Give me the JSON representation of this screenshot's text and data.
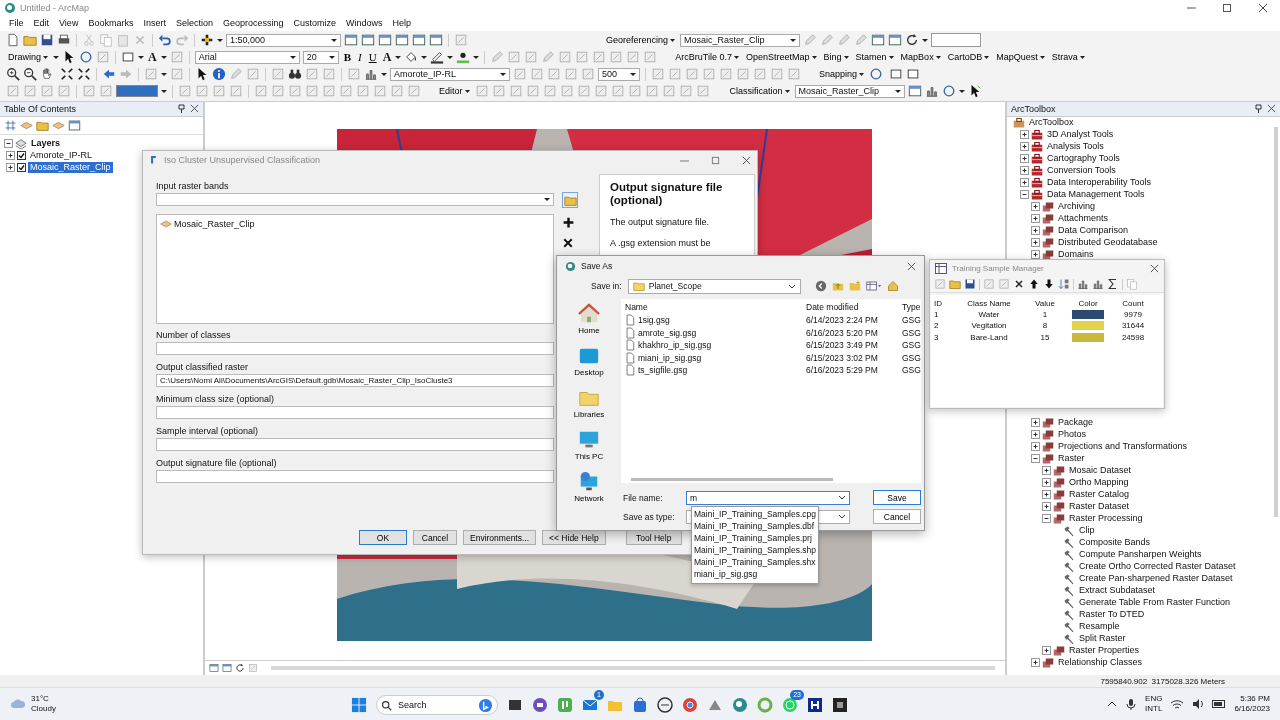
{
  "window": {
    "title": "Untitled - ArcMap"
  },
  "menu": [
    "File",
    "Edit",
    "View",
    "Bookmarks",
    "Insert",
    "Selection",
    "Geoprocessing",
    "Customize",
    "Windows",
    "Help"
  ],
  "toolbars": [
    [
      {
        "kind": "combo",
        "value": "1:50,000"
      },
      {
        "kind": "menu",
        "label": "Georeferencing"
      },
      {
        "kind": "combo",
        "value": "Mosaic_Raster_Clip"
      }
    ],
    [
      {
        "kind": "menu",
        "label": "Drawing"
      },
      {
        "kind": "glyph",
        "label": "A"
      },
      {
        "kind": "combo",
        "value": "Arial"
      },
      {
        "kind": "combo",
        "value": "20"
      },
      {
        "kind": "bold",
        "label": "B"
      },
      {
        "kind": "italic",
        "label": "I"
      },
      {
        "kind": "underline",
        "label": "U"
      },
      {
        "kind": "glyph",
        "label": "A"
      },
      {
        "kind": "menu",
        "label": "ArcBruTile 0.7"
      },
      {
        "kind": "menu",
        "label": "OpenStreetMap"
      },
      {
        "kind": "menu",
        "label": "Bing"
      },
      {
        "kind": "menu",
        "label": "Stamen"
      },
      {
        "kind": "menu",
        "label": "MapBox"
      },
      {
        "kind": "menu",
        "label": "CartoDB"
      },
      {
        "kind": "menu",
        "label": "MapQuest"
      },
      {
        "kind": "menu",
        "label": "Strava"
      }
    ],
    [
      {
        "kind": "combo",
        "value": "Amorote_IP-RL"
      },
      {
        "kind": "spin",
        "value": "500"
      },
      {
        "kind": "menu",
        "label": "Snapping"
      }
    ],
    [
      {
        "kind": "menu",
        "label": "Editor"
      },
      {
        "kind": "menu",
        "label": "Classification"
      },
      {
        "kind": "combo",
        "value": "Mosaic_Raster_Clip"
      }
    ]
  ],
  "toc": {
    "title": "Table Of Contents",
    "items": [
      {
        "label": "Layers",
        "expanded": true,
        "children": [
          {
            "label": "Amorote_IP-RL",
            "checked": true,
            "selected": false
          },
          {
            "label": "Mosaic_Raster_Clip",
            "checked": true,
            "selected": true
          }
        ]
      }
    ]
  },
  "toolbox": {
    "title": "ArcToolbox",
    "items": [
      {
        "label": "ArcToolbox",
        "kind": "root",
        "children": [
          {
            "label": "3D Analyst Tools",
            "kind": "toolbox",
            "expanded": false
          },
          {
            "label": "Analysis Tools",
            "kind": "toolbox",
            "expanded": false
          },
          {
            "label": "Cartography Tools",
            "kind": "toolbox",
            "expanded": false
          },
          {
            "label": "Conversion Tools",
            "kind": "toolbox",
            "expanded": false
          },
          {
            "label": "Data Interoperability Tools",
            "kind": "toolbox",
            "expanded": false
          },
          {
            "label": "Data Management Tools",
            "kind": "toolbox",
            "expanded": true,
            "children": [
              {
                "label": "Archiving",
                "kind": "toolset",
                "expanded": false
              },
              {
                "label": "Attachments",
                "kind": "toolset",
                "expanded": false
              },
              {
                "label": "Data Comparison",
                "kind": "toolset",
                "expanded": false
              },
              {
                "label": "Distributed Geodatabase",
                "kind": "toolset",
                "expanded": false
              },
              {
                "label": "Domains",
                "kind": "toolset",
                "expanded": false
              },
              {
                "label": "Package",
                "kind": "toolset",
                "expanded": false
              },
              {
                "label": "Photos",
                "kind": "toolset",
                "expanded": false
              },
              {
                "label": "Projections and Transformations",
                "kind": "toolset",
                "expanded": false
              },
              {
                "label": "Raster",
                "kind": "toolset",
                "expanded": true,
                "children": [
                  {
                    "label": "Mosaic Dataset",
                    "kind": "toolset",
                    "expanded": false
                  },
                  {
                    "label": "Ortho Mapping",
                    "kind": "toolset",
                    "expanded": false
                  },
                  {
                    "label": "Raster Catalog",
                    "kind": "toolset",
                    "expanded": false
                  },
                  {
                    "label": "Raster Dataset",
                    "kind": "toolset",
                    "expanded": false
                  },
                  {
                    "label": "Raster Processing",
                    "kind": "toolset",
                    "expanded": true,
                    "children": [
                      {
                        "label": "Clip",
                        "kind": "tool"
                      },
                      {
                        "label": "Composite Bands",
                        "kind": "tool"
                      },
                      {
                        "label": "Compute Pansharpen Weights",
                        "kind": "tool"
                      },
                      {
                        "label": "Create Ortho Corrected Raster Dataset",
                        "kind": "tool"
                      },
                      {
                        "label": "Create Pan-sharpened Raster Dataset",
                        "kind": "tool"
                      },
                      {
                        "label": "Extract Subdataset",
                        "kind": "tool"
                      },
                      {
                        "label": "Generate Table From Raster Function",
                        "kind": "tool"
                      },
                      {
                        "label": "Raster To DTED",
                        "kind": "tool"
                      },
                      {
                        "label": "Resample",
                        "kind": "tool"
                      },
                      {
                        "label": "Split Raster",
                        "kind": "tool"
                      }
                    ]
                  },
                  {
                    "label": "Raster Properties",
                    "kind": "toolset",
                    "expanded": false
                  }
                ]
              },
              {
                "label": "Relationship Classes",
                "kind": "toolset",
                "expanded": false
              }
            ]
          }
        ]
      }
    ]
  },
  "iso_dialog": {
    "title": "Iso Cluster Unsupervised Classification",
    "input_label": "Input raster bands",
    "input_list": [
      "Mosaic_Raster_Clip"
    ],
    "params": [
      {
        "label": "Number of classes"
      },
      {
        "label": "Output classified raster",
        "value": "C:\\Users\\Nomi Ali\\Documents\\ArcGIS\\Default.gdb\\Mosaic_Raster_Clip_IsoCluste3"
      },
      {
        "label": "Minimum class size (optional)"
      },
      {
        "label": "Sample interval (optional)"
      },
      {
        "label": "Output signature file (optional)"
      }
    ],
    "help": {
      "heading": "Output signature file (optional)",
      "paragraphs": [
        "The output signature file.",
        "A .gsg extension must be"
      ]
    },
    "buttons": [
      "OK",
      "Cancel",
      "Environments...",
      "<< Hide Help",
      "Tool Help"
    ]
  },
  "save_as": {
    "title": "Save As",
    "save_in_label": "Save in:",
    "save_in": "Planet_Scope",
    "places": [
      "Home",
      "Desktop",
      "Libraries",
      "This PC",
      "Network"
    ],
    "columns": [
      "Name",
      "Date modified",
      "Type"
    ],
    "files": [
      {
        "name": "1sig.gsg",
        "date": "6/14/2023 2:24 PM",
        "type": "GSG"
      },
      {
        "name": "amrote_sig.gsg",
        "date": "6/16/2023 5:20 PM",
        "type": "GSG"
      },
      {
        "name": "khakhro_ip_sig.gsg",
        "date": "6/15/2023 3:49 PM",
        "type": "GSG"
      },
      {
        "name": "miani_ip_sig.gsg",
        "date": "6/15/2023 3:02 PM",
        "type": "GSG"
      },
      {
        "name": "ts_sigfile.gsg",
        "date": "6/16/2023 5:29 PM",
        "type": "GSG"
      }
    ],
    "file_name_label": "File name:",
    "file_name": "m",
    "type_label": "Save as type:",
    "buttons": [
      "Save",
      "Cancel"
    ],
    "suggestions": [
      "Maini_IP_Training_Samples.cpg",
      "Maini_IP_Training_Samples.dbf",
      "Maini_IP_Training_Samples.prj",
      "Maini_IP_Training_Samples.shp",
      "Maini_IP_Training_Samples.shx",
      "miani_ip_sig.gsg"
    ]
  },
  "training_manager": {
    "title": "Training Sample Manager",
    "columns": [
      "ID",
      "Class Name",
      "Value",
      "Color",
      "Count"
    ],
    "rows": [
      {
        "id": "1",
        "name": "Water",
        "value": "1",
        "color": "#2b4a6e",
        "count": "9979"
      },
      {
        "id": "2",
        "name": "Vegitation",
        "value": "8",
        "color": "#e2d24e",
        "count": "31644"
      },
      {
        "id": "3",
        "name": "Bare-Land",
        "value": "15",
        "color": "#c9b83e",
        "count": "24598"
      }
    ]
  },
  "status_bar": {
    "coordinates": "7595840.902  3175028.326 Meters"
  },
  "taskbar": {
    "weather_temp": "31°C",
    "weather_text": "Cloudy",
    "search": "Search",
    "badges": [
      "1",
      "23"
    ],
    "language": "ENG",
    "layout": "INTL",
    "time": "5:36 PM",
    "date": "6/16/2023"
  }
}
